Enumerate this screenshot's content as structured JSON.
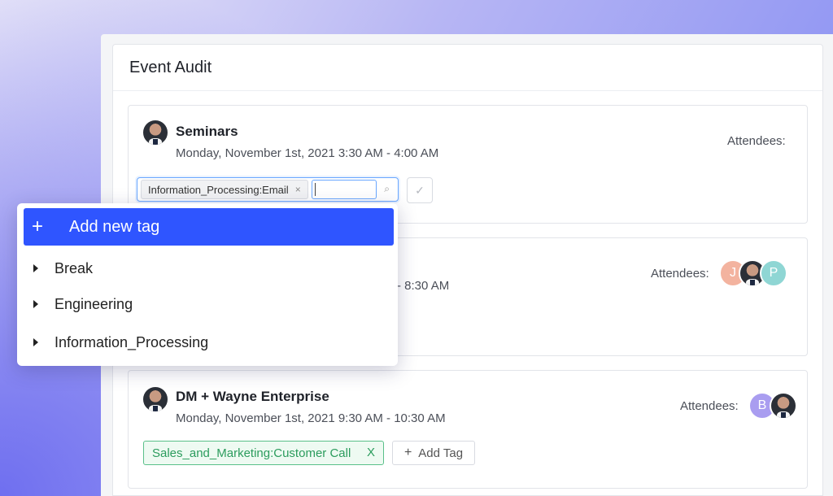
{
  "panel": {
    "title": "Event Audit"
  },
  "events": [
    {
      "title": "Seminars",
      "date": "Monday, November 1st, 2021 3:30 AM - 4:00 AM",
      "attendees_label": "Attendees:",
      "tag_input": {
        "chip": "Information_Processing:Email",
        "chip_remove": "×",
        "search_icon": "⌕",
        "confirm_icon": "✓"
      }
    },
    {
      "date_partial": "- 8:30 AM",
      "attendees_label": "Attendees:",
      "attendees": [
        "J",
        "P"
      ]
    },
    {
      "title": "DM + Wayne Enterprise",
      "date": "Monday, November 1st, 2021 9:30 AM - 10:30 AM",
      "attendees_label": "Attendees:",
      "attendees": [
        "B"
      ],
      "tag": "Sales_and_Marketing:Customer Call",
      "tag_remove": "X",
      "add_tag": "Add Tag",
      "add_tag_icon": "+"
    }
  ],
  "dropdown": {
    "add_label": "Add new tag",
    "add_icon": "+",
    "items": [
      "Break",
      "Engineering",
      "Information_Processing"
    ]
  },
  "colors": {
    "primary": "#2f55ff",
    "success": "#2b9c5d",
    "avatar_j": "#f3b39f",
    "avatar_p": "#8fd6d4",
    "avatar_b": "#a99df0"
  }
}
